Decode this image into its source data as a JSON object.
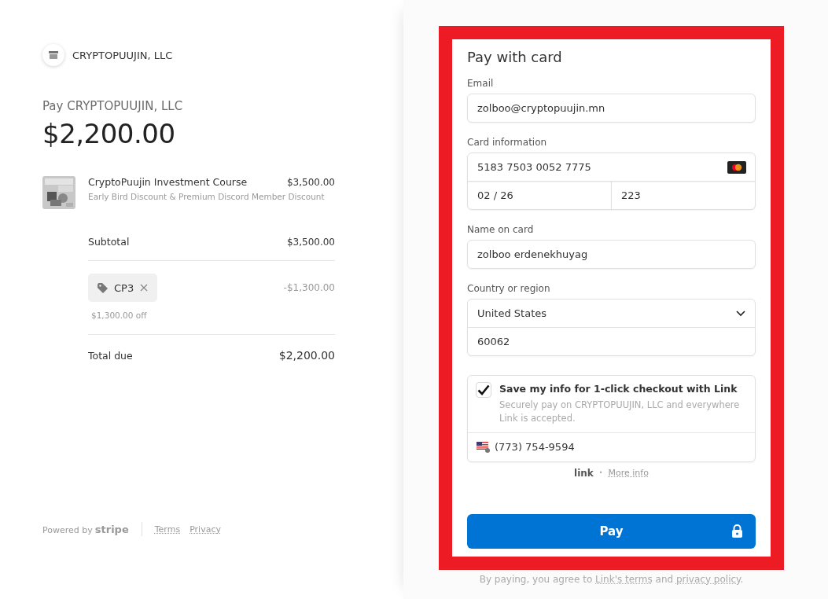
{
  "merchant": {
    "name": "CRYPTOPUUJIN, LLC"
  },
  "summary": {
    "pay_label": "Pay CRYPTOPUUJIN, LLC",
    "amount": "$2,200.00"
  },
  "line_item": {
    "name": "CryptoPuujin Investment Course",
    "price": "$3,500.00",
    "description": "Early Bird Discount & Premium Discord Member Discount"
  },
  "subtotal": {
    "label": "Subtotal",
    "value": "$3,500.00"
  },
  "promo": {
    "code": "CP3",
    "note": "$1,300.00 off",
    "value": "-$1,300.00"
  },
  "total": {
    "label": "Total due",
    "value": "$2,200.00"
  },
  "footer": {
    "powered_by": "Powered by",
    "brand": "stripe",
    "links": [
      "Terms",
      "Privacy"
    ]
  },
  "form": {
    "title": "Pay with card",
    "email": {
      "label": "Email",
      "value": "zolboo@cryptopuujin.mn"
    },
    "card": {
      "label": "Card information",
      "number": "5183 7503 0052 7775",
      "expiry": "02 / 26",
      "cvc": "223"
    },
    "name": {
      "label": "Name on card",
      "value": "zolboo erdenekhuyag"
    },
    "country": {
      "label": "Country or region",
      "value": "United States",
      "postal": "60062"
    },
    "link_save": {
      "checked": true,
      "title": "Save my info for 1-click checkout with Link",
      "description": "Securely pay on CRYPTOPUUJIN, LLC and everywhere Link is accepted.",
      "phone": "(773) 754-9594"
    },
    "link_footer": {
      "brand": "link",
      "separator": "•",
      "more": "More info"
    },
    "pay_button": "Pay",
    "legal": {
      "prefix": "By paying, you agree to ",
      "terms": "Link's terms",
      "middle": " and ",
      "privacy": "privacy policy",
      "suffix": "."
    }
  }
}
